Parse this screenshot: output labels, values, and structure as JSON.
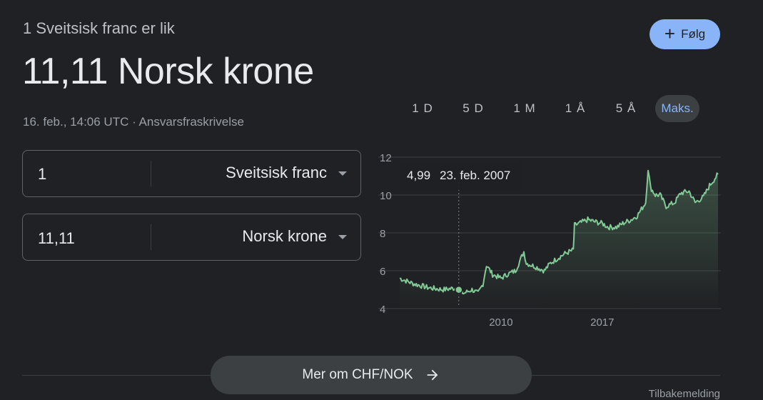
{
  "header": {
    "subtitle": "1 Sveitsisk franc er lik",
    "value": "11,11 Norsk krone",
    "timestamp": "16. feb., 14:06 UTC",
    "separator": " · ",
    "disclaimer": "Ansvarsfraskrivelse",
    "follow_label": "Følg",
    "follow_icon": "plus-icon"
  },
  "converter": {
    "from": {
      "amount": "1",
      "currency": "Sveitsisk franc"
    },
    "to": {
      "amount": "11,11",
      "currency": "Norsk krone"
    }
  },
  "ranges": [
    "1 D",
    "5 D",
    "1 M",
    "1 Å",
    "5 Å",
    "Maks."
  ],
  "active_range": "Maks.",
  "tooltip": {
    "value": "4,99",
    "date": "23. feb. 2007"
  },
  "colors": {
    "line": "#81c995",
    "accent": "#8ab4f8",
    "background": "#202124"
  },
  "chart_data": {
    "type": "line",
    "y_ticks": [
      "12",
      "10",
      "8",
      "6",
      "4"
    ],
    "x_ticks": [
      "2010",
      "2017"
    ],
    "ylim": [
      4,
      12
    ],
    "grid": true,
    "series": [
      {
        "x": [
          "2003-01",
          "2004-01",
          "2005-01",
          "2006-01",
          "2007-01",
          "2007-06",
          "2008-01",
          "2008-06",
          "2008-10",
          "2009-01",
          "2009-06",
          "2010-01",
          "2010-06",
          "2011-01",
          "2011-08",
          "2011-10",
          "2012-06",
          "2013-01",
          "2013-06",
          "2014-01",
          "2014-06",
          "2015-01",
          "2015-02",
          "2015-06",
          "2016-01",
          "2016-06",
          "2017-01",
          "2017-06",
          "2018-01",
          "2018-06",
          "2019-01",
          "2019-06",
          "2020-01",
          "2020-03",
          "2020-05",
          "2020-09",
          "2021-01",
          "2021-06",
          "2022-01",
          "2022-06",
          "2023-01",
          "2023-06",
          "2024-01",
          "2024-06",
          "2025-01"
        ],
        "y": [
          5.6,
          5.3,
          5.1,
          5.0,
          5.1,
          4.8,
          5.0,
          4.8,
          5.3,
          6.3,
          5.8,
          5.6,
          5.8,
          6.0,
          7.0,
          6.4,
          6.2,
          6.0,
          6.4,
          6.7,
          6.9,
          7.1,
          8.4,
          8.5,
          8.7,
          8.6,
          8.5,
          8.3,
          8.3,
          8.5,
          8.7,
          8.9,
          9.6,
          11.4,
          10.4,
          10.0,
          10.0,
          9.4,
          9.6,
          10.1,
          10.2,
          9.6,
          9.9,
          10.5,
          11.1
        ]
      }
    ]
  },
  "more_button": {
    "label": "Mer om CHF/NOK",
    "icon": "arrow-right-icon"
  },
  "footer": {
    "feedback": "Tilbakemelding"
  }
}
